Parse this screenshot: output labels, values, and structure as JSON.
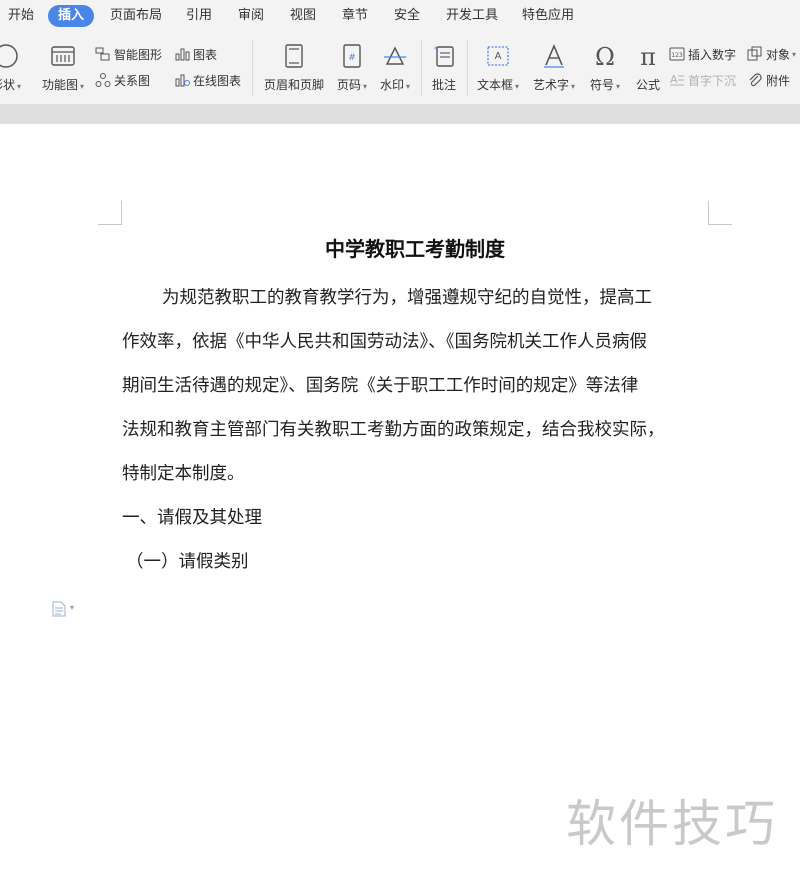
{
  "menu": {
    "tabs": [
      "开始",
      "插入",
      "页面布局",
      "引用",
      "审阅",
      "视图",
      "章节",
      "安全",
      "开发工具",
      "特色应用"
    ],
    "active": "插入"
  },
  "ribbon": {
    "shape": "形状",
    "function_chart": "功能图",
    "smart_art": "智能图形",
    "chart": "图表",
    "relation_chart": "关系图",
    "online_chart": "在线图表",
    "header_footer": "页眉和页脚",
    "page_number": "页码",
    "watermark": "水印",
    "comment": "批注",
    "text_box": "文本框",
    "word_art": "艺术字",
    "symbol": "符号",
    "formula": "公式",
    "insert_number": "插入数字",
    "drop_cap": "首字下沉",
    "object": "对象",
    "attachment": "附件",
    "number_icon_text": "123"
  },
  "document": {
    "title": "中学教职工考勤制度",
    "lines": [
      "为规范教职工的教育教学行为，增强遵规守纪的自觉性，提高工",
      "作效率，依据《中华人民共和国劳动法》、《国务院机关工作人员病假",
      "期间生活待遇的规定》、国务院《关于职工工作时间的规定》等法律",
      "法规和教育主管部门有关教职工考勤方面的政策规定，结合我校实际，",
      "特制定本制度。",
      "一、请假及其处理",
      "（一）请假类别"
    ]
  },
  "watermark_text": "软件技巧",
  "colors": {
    "active_tab": "#4a86e8",
    "ribbon_bg": "#f3f3f3",
    "icon": "#555555"
  }
}
